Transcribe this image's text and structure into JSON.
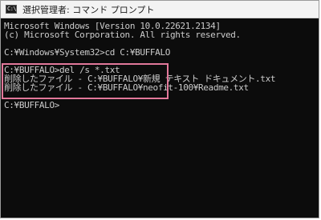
{
  "window": {
    "title": "選択管理者: コマンド プロンプト",
    "icon": "command-prompt-icon"
  },
  "console": {
    "lines": [
      "Microsoft Windows [Version 10.0.22621.2134]",
      "(c) Microsoft Corporation. All rights reserved.",
      "",
      "C:¥Windows¥System32>cd C:¥BUFFALO",
      "",
      "C:¥BUFFALO>del /s *.txt",
      "削除したファイル - C:¥BUFFALO¥新規 テキスト ドキュメント.txt",
      "削除したファイル - C:¥BUFFALO¥neofit-100¥Readme.txt",
      "",
      "C:¥BUFFALO>"
    ]
  },
  "colors": {
    "console_background": "#0c0c0c",
    "console_text": "#cccccc",
    "highlight_border": "#e2789a",
    "titlebar_background": "#f3f3f3"
  }
}
